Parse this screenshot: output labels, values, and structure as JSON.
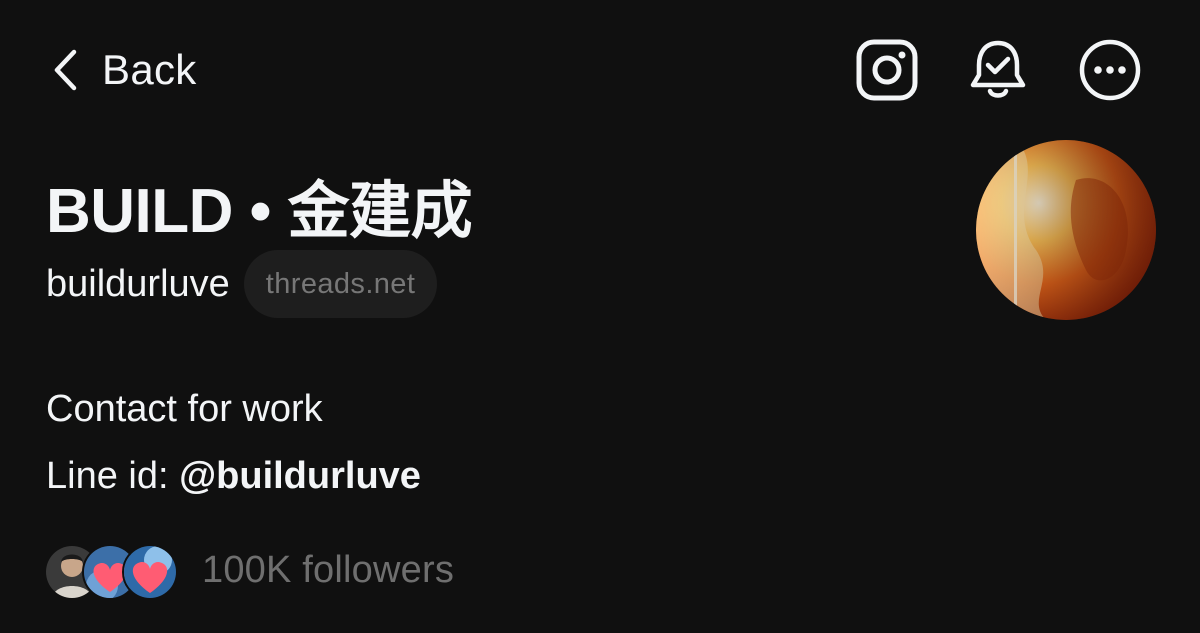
{
  "nav": {
    "back_label": "Back",
    "icons": [
      "chevron-left-icon",
      "instagram-icon",
      "notification-bell-icon",
      "more-options-icon"
    ]
  },
  "profile": {
    "display_name": "BUILD • 金建成",
    "username": "buildurluve",
    "domain_badge": "threads.net",
    "bio": {
      "line1": "Contact for work",
      "line2_prefix": "Line id: ",
      "line2_mention": "@buildurluve"
    },
    "followers_label": "100K followers"
  },
  "colors": {
    "background": "#101010",
    "primary_text": "#f3f5f7",
    "secondary_text": "#777777",
    "pill_background": "#1e1e1e"
  }
}
